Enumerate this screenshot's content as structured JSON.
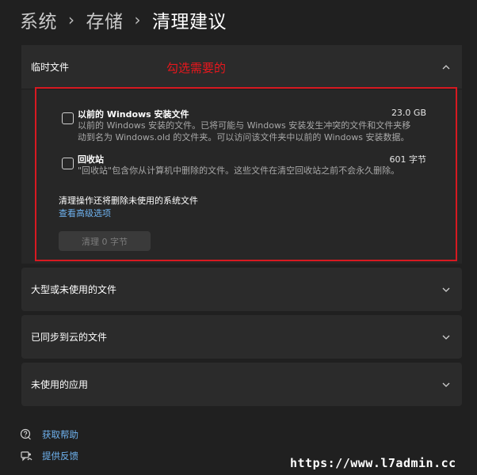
{
  "breadcrumb": {
    "level1": "系统",
    "level2": "存储",
    "current": "清理建议",
    "separator": "›"
  },
  "annotation": {
    "text": "勾选需要的",
    "color": "#d71921"
  },
  "temp_files": {
    "title": "临时文件",
    "expanded": true,
    "items": [
      {
        "title": "以前的 Windows 安装文件",
        "size": "23.0 GB",
        "checked": false,
        "desc_line1": "以前的 Windows 安装的文件。已将可能与 Windows 安装发生冲突的文件和文件夹移",
        "desc_line2": "动到名为 Windows.old 的文件夹。可以访问该文件夹中以前的 Windows 安装数据。"
      },
      {
        "title": "回收站",
        "size": "601 字节",
        "checked": false,
        "desc_line1": "\"回收站\"包含你从计算机中删除的文件。这些文件在清空回收站之前不会永久删除。"
      }
    ],
    "cleanup_note": "清理操作还将删除未使用的系统文件",
    "advanced_link": "查看高级选项",
    "clean_button": "清理 0 字节"
  },
  "sections": [
    {
      "title": "大型或未使用的文件"
    },
    {
      "title": "已同步到云的文件"
    },
    {
      "title": "未使用的应用"
    }
  ],
  "footer": {
    "help": "获取帮助",
    "feedback": "提供反馈"
  },
  "watermark": "https://www.l7admin.cc",
  "colors": {
    "background": "#202020",
    "card": "#2b2b2b",
    "link": "#6fb3f0",
    "annotation": "#d71921"
  }
}
